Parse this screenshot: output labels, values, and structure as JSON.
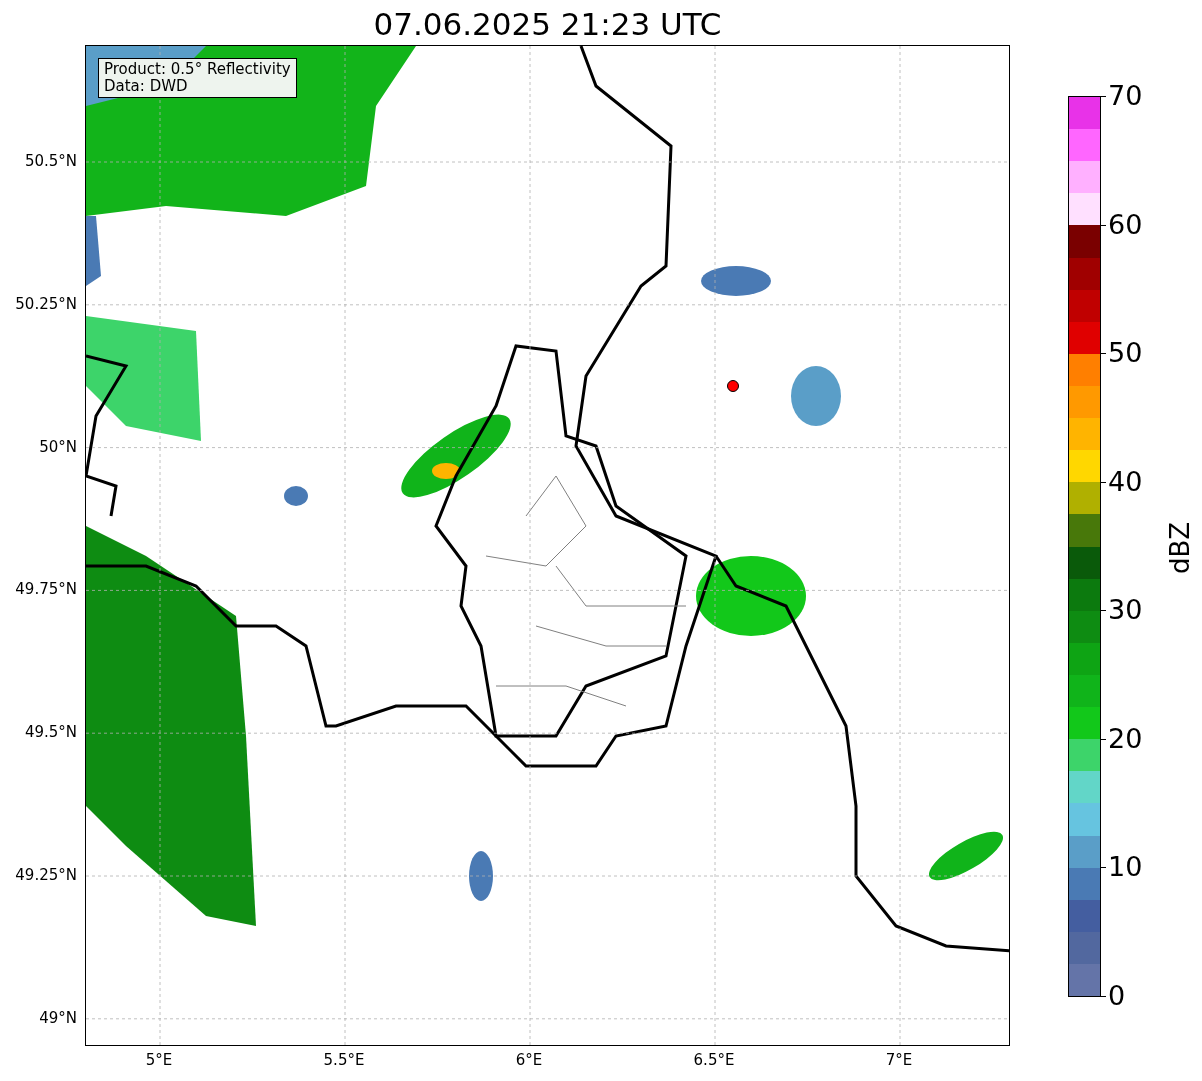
{
  "title": "07.06.2025 21:23 UTC",
  "legend": {
    "lines": [
      "Product: 0.5° Reflectivity",
      "Data: DWD"
    ]
  },
  "map": {
    "y_ticks": [
      "50.5°N",
      "50.25°N",
      "50°N",
      "49.75°N",
      "49.5°N",
      "49.25°N",
      "49°N"
    ],
    "x_ticks": [
      "5°E",
      "5.5°E",
      "6°E",
      "6.5°E",
      "7°E"
    ]
  },
  "colorbar": {
    "label": "dBZ",
    "ticks": [
      "70",
      "60",
      "50",
      "40",
      "30",
      "20",
      "10",
      "0"
    ],
    "bins": [
      {
        "color": "#e832e8"
      },
      {
        "color": "#ff66ff"
      },
      {
        "color": "#ffb0ff"
      },
      {
        "color": "#ffe0ff"
      },
      {
        "color": "#7a0000"
      },
      {
        "color": "#a00000"
      },
      {
        "color": "#c00000"
      },
      {
        "color": "#e00000"
      },
      {
        "color": "#ff7f00"
      },
      {
        "color": "#ff9900"
      },
      {
        "color": "#ffb400"
      },
      {
        "color": "#ffd700"
      },
      {
        "color": "#b0b000"
      },
      {
        "color": "#48780a"
      },
      {
        "color": "#0a5a0a"
      },
      {
        "color": "#0c7a0e"
      },
      {
        "color": "#0e8c12"
      },
      {
        "color": "#0ea414"
      },
      {
        "color": "#10b41a"
      },
      {
        "color": "#12c81a"
      },
      {
        "color": "#3dd46a"
      },
      {
        "color": "#62d6c8"
      },
      {
        "color": "#66c4e0"
      },
      {
        "color": "#5a9ec8"
      },
      {
        "color": "#4a7ab4"
      },
      {
        "color": "#445ea0"
      },
      {
        "color": "#52689f"
      },
      {
        "color": "#6474a8"
      }
    ]
  }
}
